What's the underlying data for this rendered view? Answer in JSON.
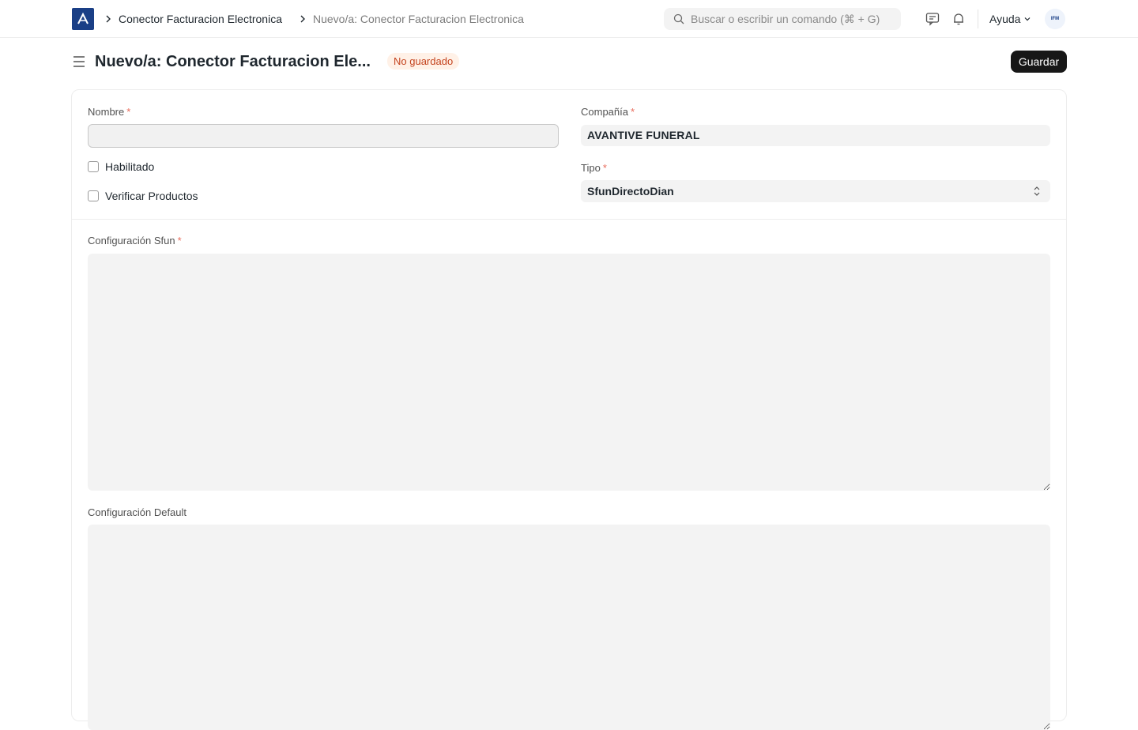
{
  "navbar": {
    "breadcrumbs": [
      "Conector Facturacion Electronica",
      "Nuevo/a: Conector Facturacion Electronica"
    ],
    "search_placeholder": "Buscar o escribir un comando (⌘ + G)",
    "help_label": "Ayuda",
    "avatar_initials": "IFM"
  },
  "page": {
    "title": "Nuevo/a: Conector Facturacion Ele...",
    "status_badge": "No guardado",
    "save_label": "Guardar"
  },
  "form": {
    "nombre": {
      "label": "Nombre",
      "value": ""
    },
    "habilitado_label": "Habilitado",
    "verificar_label": "Verificar Productos",
    "compania": {
      "label": "Compañía",
      "value": "AVANTIVE FUNERAL"
    },
    "tipo": {
      "label": "Tipo",
      "value": "SfunDirectoDian"
    },
    "config_sfun": {
      "label": "Configuración Sfun",
      "value": ""
    },
    "config_default": {
      "label": "Configuración Default",
      "value": ""
    }
  },
  "colors": {
    "accent": "#171717",
    "logo": "#1a3f86",
    "badge_bg": "#fff1e7",
    "badge_text": "#c4431e",
    "required": "#e86c5c"
  }
}
